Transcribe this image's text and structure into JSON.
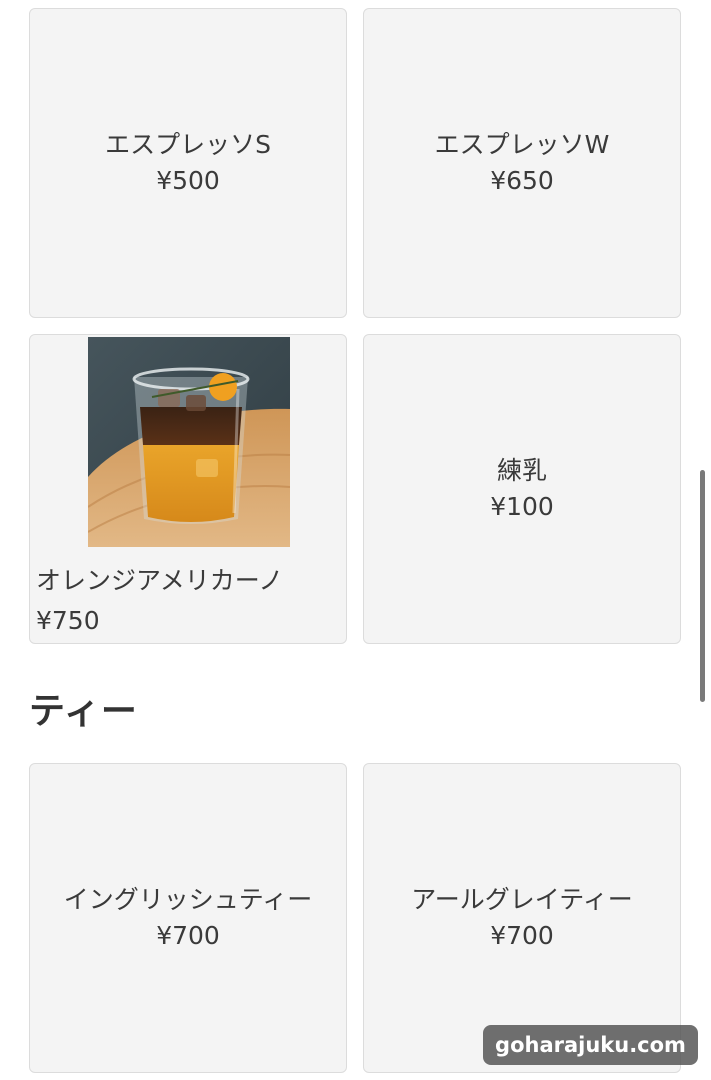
{
  "menu": {
    "items": [
      {
        "name": "エスプレッソS",
        "price": "¥500"
      },
      {
        "name": "エスプレッソW",
        "price": "¥650"
      },
      {
        "name": "オレンジアメリカーノ",
        "price": "¥750"
      },
      {
        "name": "練乳",
        "price": "¥100"
      }
    ]
  },
  "tea": {
    "heading": "ティー",
    "items": [
      {
        "name": "イングリッシュティー",
        "price": "¥700"
      },
      {
        "name": "アールグレイティー",
        "price": "¥700"
      }
    ]
  },
  "watermark": {
    "text": "goharajuku.com"
  }
}
